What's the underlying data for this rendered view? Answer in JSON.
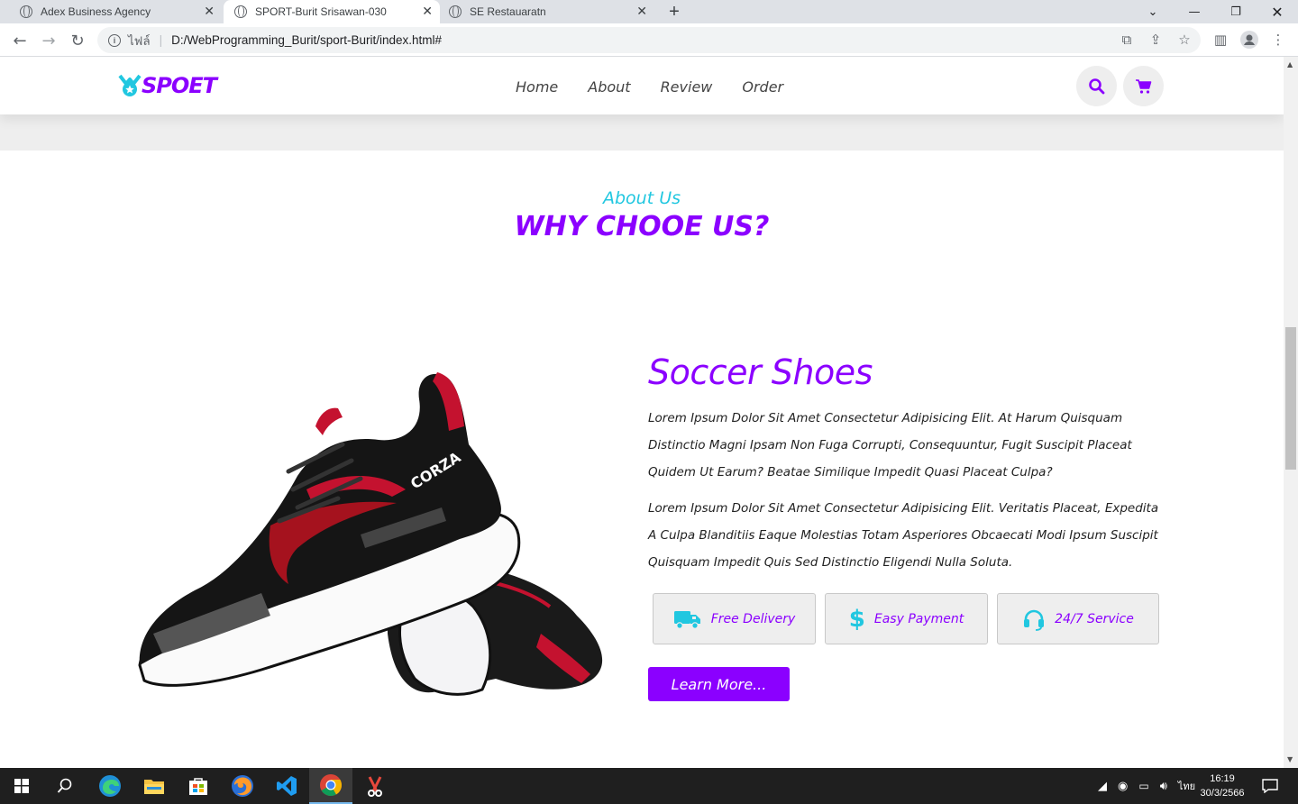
{
  "browser": {
    "tabs": [
      {
        "title": "Adex Business Agency",
        "active": false
      },
      {
        "title": "SPORT-Burit Srisawan-030",
        "active": true
      },
      {
        "title": "SE Restauaratn",
        "active": false
      }
    ],
    "new_tab_label": "+",
    "address": {
      "scheme_label": "ไฟล์",
      "url": "D:/WebProgramming_Burit/sport-Burit/index.html#"
    }
  },
  "site": {
    "logo_text": "SPOET",
    "nav": [
      "Home",
      "About",
      "Review",
      "Order"
    ],
    "colors": {
      "accent": "#8b00ff",
      "cyan": "#21c7e0"
    }
  },
  "about": {
    "subtitle": "About Us",
    "title": "WHY CHOOE US?",
    "product_title": "Soccer Shoes",
    "paragraph_1": "Lorem Ipsum Dolor Sit Amet Consectetur Adipisicing Elit. At Harum Quisquam Distinctio Magni Ipsam Non Fuga Corrupti, Consequuntur, Fugit Suscipit Placeat Quidem Ut Earum? Beatae Similique Impedit Quasi Placeat Culpa?",
    "paragraph_2": "Lorem Ipsum Dolor Sit Amet Consectetur Adipisicing Elit. Veritatis Placeat, Expedita A Culpa Blanditiis Eaque Molestias Totam Asperiores Obcaecati Modi Ipsum Suscipit Quisquam Impedit Quis Sed Distinctio Eligendi Nulla Soluta.",
    "features": [
      {
        "label": "Free Delivery",
        "icon": "truck-icon"
      },
      {
        "label": "Easy Payment",
        "icon": "dollar-icon"
      },
      {
        "label": "24/7 Service",
        "icon": "headset-icon"
      }
    ],
    "button_label": "Learn More..."
  },
  "taskbar": {
    "language": "ไทย",
    "time": "16:19",
    "date": "30/3/2566"
  }
}
